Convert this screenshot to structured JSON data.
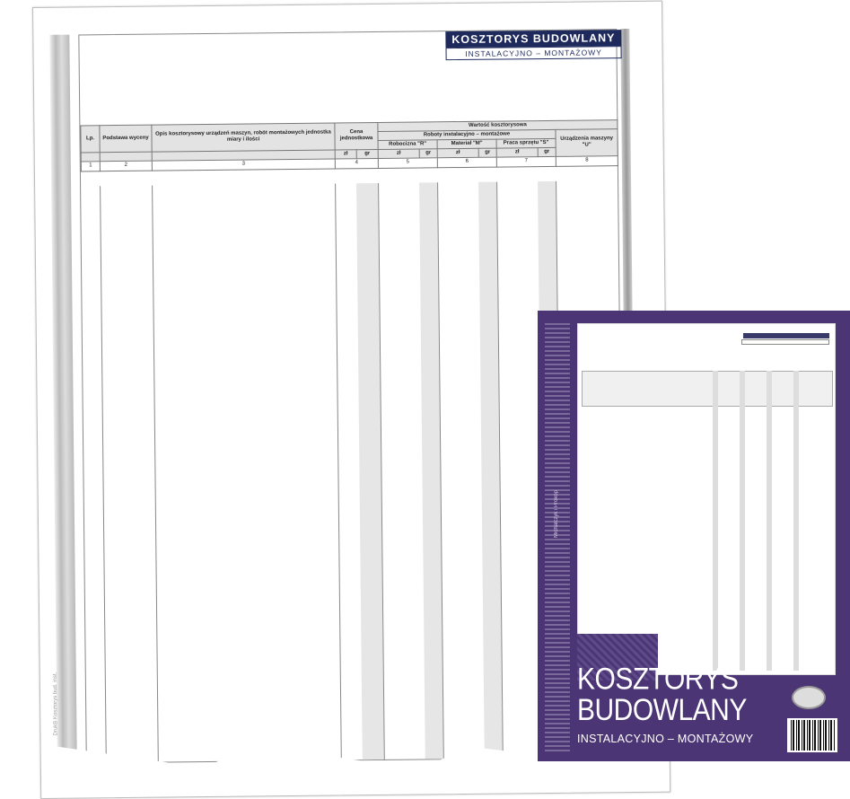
{
  "form": {
    "title": "KOSZTORYS BUDOWLANY",
    "subtitle": "INSTALACYJNO – MONTAŻOWY",
    "side_code": "DrukB Kosztorys bud. inst.",
    "headers": {
      "lp": "Lp.",
      "basis": "Podstawa wyceny",
      "description": "Opis kosztorysowy urządzeń maszyn, robót montażowych jednostka miary i ilości",
      "unit_price": "Cena jednostkowa",
      "cost_value": "Wartość kosztorysowa",
      "install_works": "Roboty instalacyjno – montażowe",
      "labor": "Robocizna \"R\"",
      "material": "Materiał \"M\"",
      "equipment": "Praca sprzętu \"S\"",
      "machinery": "Urządzenia maszyny \"U\"",
      "zl": "zł",
      "gr": "gr"
    },
    "column_numbers": [
      "1",
      "2",
      "3",
      "4",
      "5",
      "6",
      "7",
      "8"
    ]
  },
  "cover": {
    "title_line1": "KOSZTORYS",
    "title_line2": "BUDOWLANY",
    "subtitle": "INSTALACYJNO – MONTAŻOWY",
    "brand": "Michalczyk i Prokop"
  }
}
